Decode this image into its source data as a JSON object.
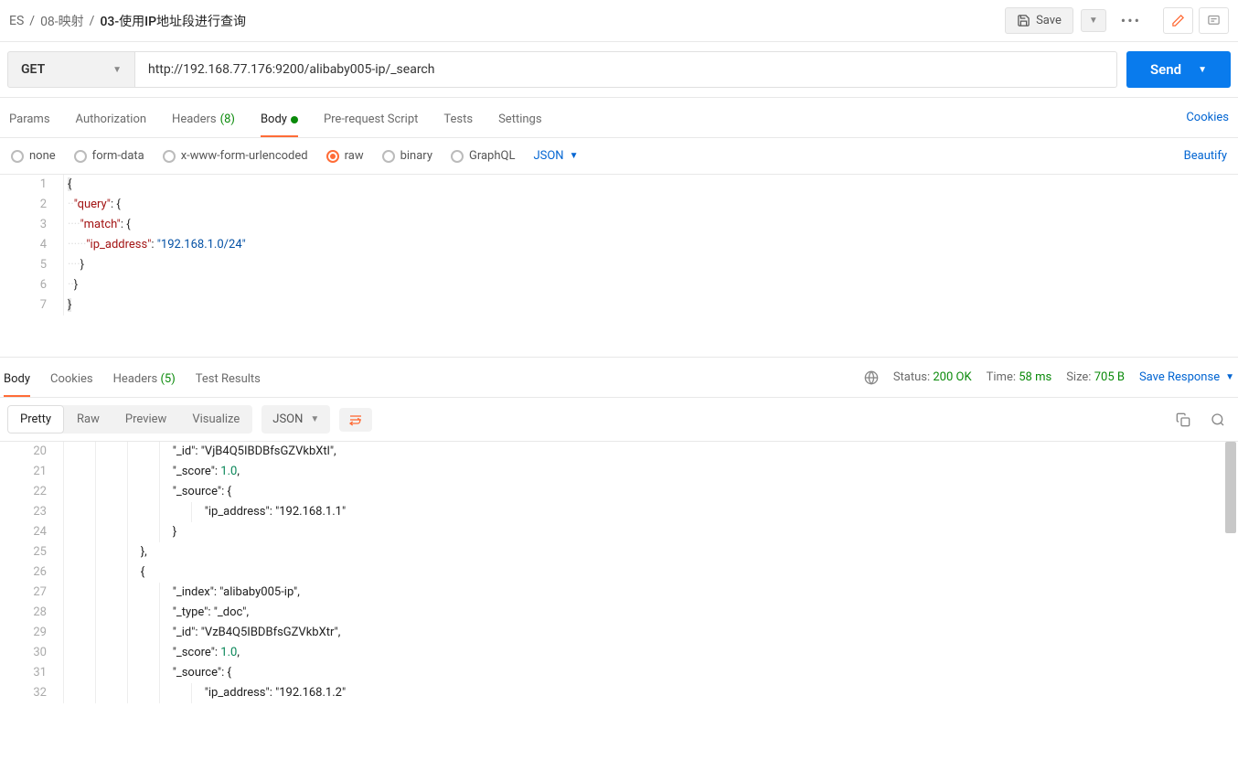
{
  "breadcrumb": {
    "a": "ES",
    "b": "08-映射",
    "c": "03-使用IP地址段进行查询"
  },
  "topbar": {
    "save": "Save"
  },
  "request": {
    "method": "GET",
    "url": "http://192.168.77.176:9200/alibaby005-ip/_search",
    "send": "Send"
  },
  "tabs": {
    "params": "Params",
    "auth": "Authorization",
    "headers": "Headers",
    "headers_count": "(8)",
    "body": "Body",
    "prerequest": "Pre-request Script",
    "tests": "Tests",
    "settings": "Settings",
    "cookies": "Cookies"
  },
  "bodytypes": {
    "none": "none",
    "formdata": "form-data",
    "xform": "x-www-form-urlencoded",
    "raw": "raw",
    "binary": "binary",
    "graphql": "GraphQL",
    "json": "JSON",
    "beautify": "Beautify"
  },
  "editor": {
    "l1": "1",
    "l2": "2",
    "l3": "3",
    "l4": "4",
    "l5": "5",
    "l6": "6",
    "l7": "7",
    "query_key": "\"query\"",
    "match_key": "\"match\"",
    "ip_key": "\"ip_address\"",
    "ip_val": "\"192.168.1.0/24\""
  },
  "rtabs": {
    "body": "Body",
    "cookies": "Cookies",
    "headers": "Headers",
    "headers_count": "(5)",
    "tests": "Test Results"
  },
  "status": {
    "status_lbl": "Status:",
    "status_val": "200 OK",
    "time_lbl": "Time:",
    "time_val": "58 ms",
    "size_lbl": "Size:",
    "size_val": "705 B",
    "save": "Save Response"
  },
  "view": {
    "pretty": "Pretty",
    "raw": "Raw",
    "preview": "Preview",
    "visualize": "Visualize",
    "json": "JSON"
  },
  "resp": {
    "n20": "20",
    "n21": "21",
    "n22": "22",
    "n23": "23",
    "n24": "24",
    "n25": "25",
    "n26": "26",
    "n27": "27",
    "n28": "28",
    "n29": "29",
    "n30": "30",
    "n31": "31",
    "n32": "32",
    "id_key": "\"_id\"",
    "id1": "\"VjB4Q5IBDBfsGZVkbXtl\"",
    "score_key": "\"_score\"",
    "score_val": "1.0",
    "source_key": "\"_source\"",
    "ip_key": "\"ip_address\"",
    "ip1": "\"192.168.1.1\"",
    "index_key": "\"_index\"",
    "index_val": "\"alibaby005-ip\"",
    "type_key": "\"_type\"",
    "type_val": "\"_doc\"",
    "id2": "\"VzB4Q5IBDBfsGZVkbXtr\"",
    "ip2": "\"192.168.1.2\""
  }
}
